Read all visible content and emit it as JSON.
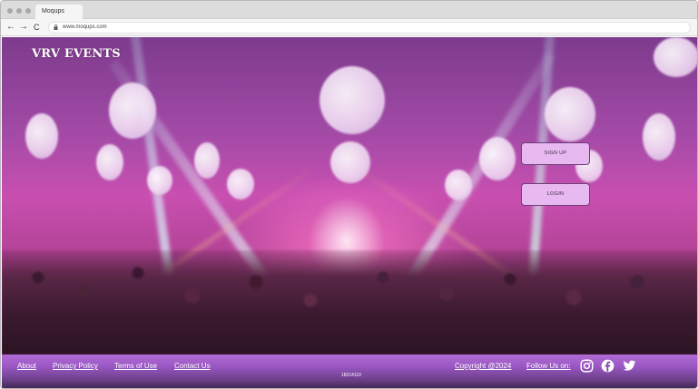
{
  "browser": {
    "tab_title": "Moqups",
    "url": "www.moqups.com",
    "icons": {
      "back": "←",
      "forward": "→",
      "reload": "C"
    }
  },
  "hero": {
    "title": "VRV EVENTS",
    "background": "concert-crowd-with-stage-lights",
    "colors": {
      "accent": "#c84fb0",
      "button_bg": "#e8b9f0",
      "button_border": "#6f3f77"
    }
  },
  "actions": {
    "signup_label": "SIGN UP",
    "login_label": "LOGIN"
  },
  "footer": {
    "links": {
      "about": "About",
      "privacy": "Privacy Policy",
      "terms": "Terms of Use",
      "contact": "Contact Us"
    },
    "version": "18214110",
    "copyright": "Copyright @2024",
    "follow": "Follow Us on:",
    "social_icons": [
      "instagram-icon",
      "facebook-icon",
      "twitter-icon"
    ],
    "colors": {
      "top": "#b16bd6",
      "bottom": "#3c2750"
    }
  }
}
